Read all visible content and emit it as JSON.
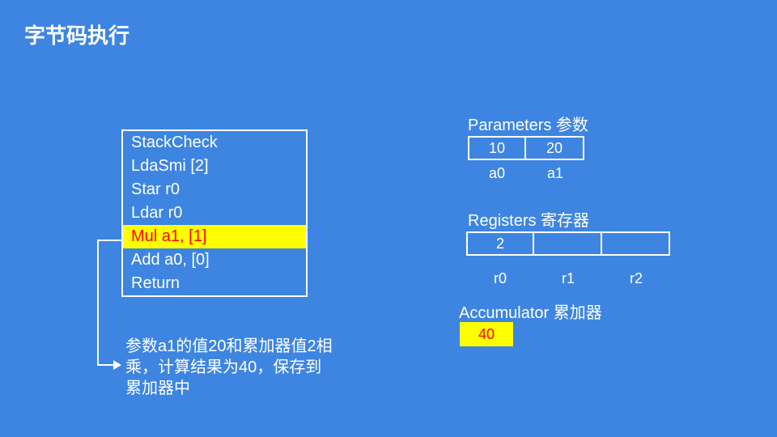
{
  "title": "字节码执行",
  "bytecode": {
    "lines": [
      {
        "text": "StackCheck",
        "hl": false
      },
      {
        "text": "LdaSmi [2]",
        "hl": false
      },
      {
        "text": "Star r0",
        "hl": false
      },
      {
        "text": "Ldar r0",
        "hl": false
      },
      {
        "text": "Mul a1, [1]",
        "hl": true
      },
      {
        "text": "Add a0, [0]",
        "hl": false
      },
      {
        "text": "Return",
        "hl": false
      }
    ]
  },
  "explanation": "参数a1的值20和累加器值2相乘，计算结果为40，保存到累加器中",
  "parameters": {
    "title": "Parameters 参数",
    "cells": [
      "10",
      "20"
    ],
    "labels": [
      "a0",
      "a1"
    ]
  },
  "registers": {
    "title": "Registers 寄存器",
    "cells": [
      "2",
      "",
      ""
    ],
    "labels": [
      "r0",
      "r1",
      "r2"
    ]
  },
  "accumulator": {
    "title": "Accumulator 累加器",
    "value": "40"
  }
}
